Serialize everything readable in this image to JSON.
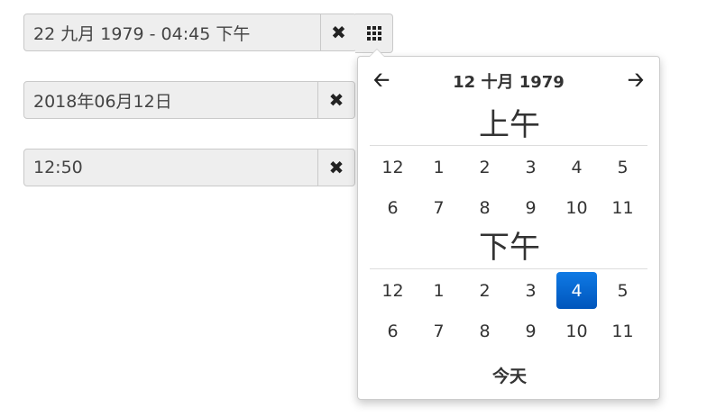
{
  "inputs": [
    {
      "value": "22 九月 1979 - 04:45 下午",
      "clear_icon": "times-icon"
    },
    {
      "value": "2018年06月12日",
      "clear_icon": "times-icon"
    },
    {
      "value": "12:50",
      "clear_icon": "times-icon"
    }
  ],
  "picker_button_icon": "th-grid-icon",
  "popup": {
    "prev_icon": "arrow-left-icon",
    "next_icon": "arrow-right-icon",
    "title": "12 十月 1979",
    "am_label": "上午",
    "pm_label": "下午",
    "am_hours": [
      "12",
      "1",
      "2",
      "3",
      "4",
      "5",
      "6",
      "7",
      "8",
      "9",
      "10",
      "11"
    ],
    "pm_hours": [
      "12",
      "1",
      "2",
      "3",
      "4",
      "5",
      "6",
      "7",
      "8",
      "9",
      "10",
      "11"
    ],
    "selected_pm_hour": "4",
    "today_label": "今天",
    "accent_color": "#0a6fd1"
  }
}
